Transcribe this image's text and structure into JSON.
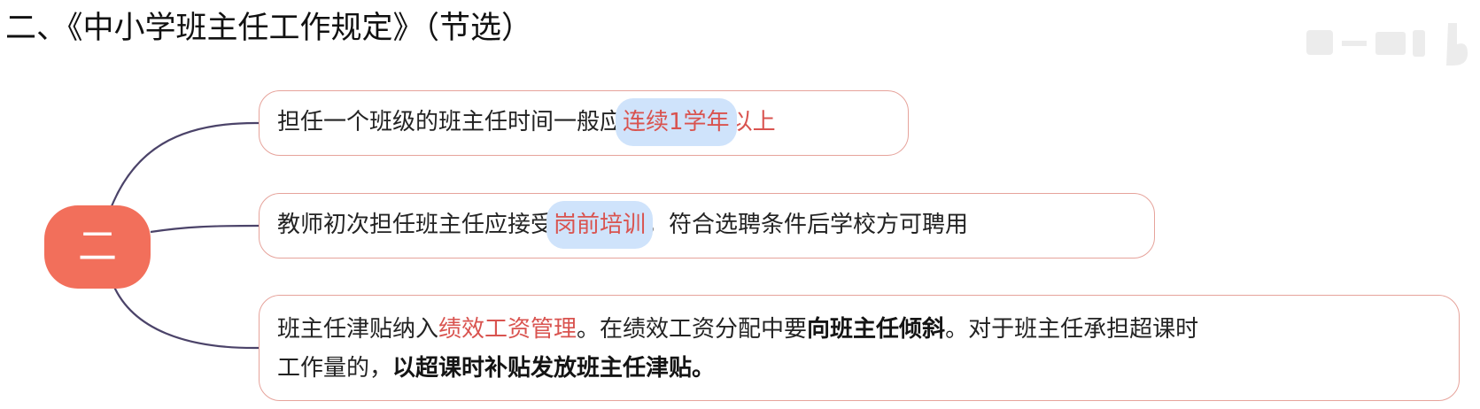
{
  "title": "二、《中小学班主任工作规定》（节选）",
  "root": {
    "label": "二",
    "fill_color": "#f26f5b"
  },
  "colors": {
    "line": "#4b4369",
    "branch_border": "#e6a39b",
    "highlight_text": "#d9534f",
    "highlight_bg": "#cfe3fb"
  },
  "branches": [
    {
      "text_before": "担任一个班级的班主任时间一般应",
      "highlight": "连续1学年",
      "text_after": "以上"
    },
    {
      "text_before": "教师初次担任班主任应接受",
      "highlight": "岗前培训",
      "text_after": "，符合选聘条件后学校方可聘用"
    },
    {
      "line1_part1": "班主任津贴纳入",
      "line1_highlight": "绩效工资管理",
      "line1_part2": "。在绩效工资分配中要",
      "line1_bold": "向班主任倾斜",
      "line1_part3": "。对于班主任承担超课时",
      "line2_part1": "工作量的，",
      "line2_bold": "以超课时补贴发放班主任津贴。"
    }
  ]
}
